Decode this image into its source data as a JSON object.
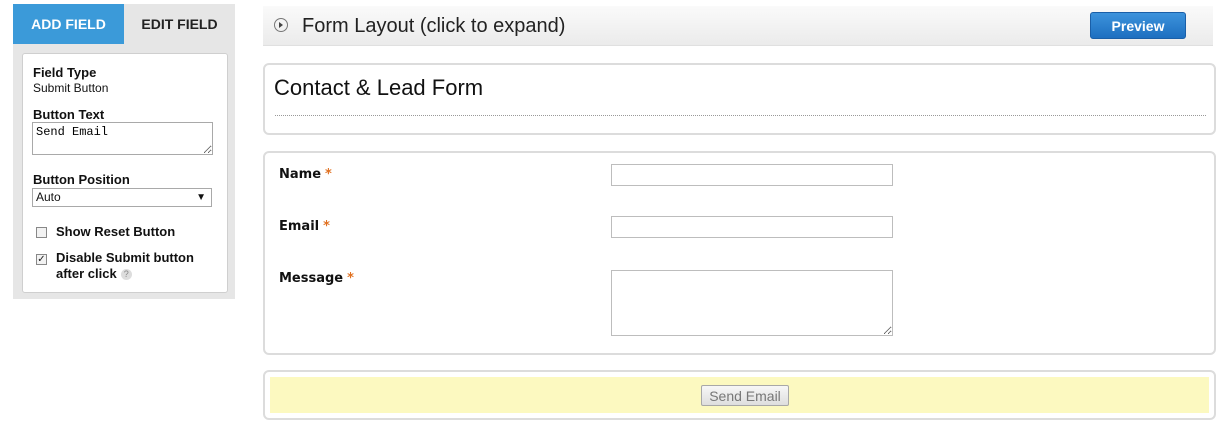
{
  "sidebar": {
    "tabs": [
      {
        "label": "ADD FIELD",
        "active": true
      },
      {
        "label": "EDIT FIELD",
        "active": false
      }
    ],
    "field_type_label": "Field Type",
    "field_type_value": "Submit Button",
    "button_text_label": "Button Text",
    "button_text_value": "Send Email",
    "button_position_label": "Button Position",
    "button_position_value": "Auto",
    "show_reset": {
      "label": "Show Reset Button",
      "checked": false
    },
    "disable_submit": {
      "label_line1": "Disable Submit button",
      "label_line2": "after click",
      "checked": true
    },
    "help_glyph": "?"
  },
  "layout_bar": {
    "title": "Form Layout (click to expand)",
    "preview_label": "Preview"
  },
  "form": {
    "title": "Contact & Lead Form",
    "fields": [
      {
        "label": "Name",
        "required_mark": "*",
        "type": "text"
      },
      {
        "label": "Email",
        "required_mark": "*",
        "type": "text"
      },
      {
        "label": "Message",
        "required_mark": "*",
        "type": "textarea"
      }
    ],
    "submit_label": "Send Email"
  },
  "colors": {
    "tab_active": "#3b9ad9",
    "preview_button": "#2a7fd0",
    "required": "#e07020",
    "submit_area": "#fcf9c0"
  },
  "icons": {
    "expand": "expand-circle-icon",
    "checkbox_checked": "check-icon",
    "dropdown": "chevron-down-icon",
    "help": "help-icon"
  }
}
